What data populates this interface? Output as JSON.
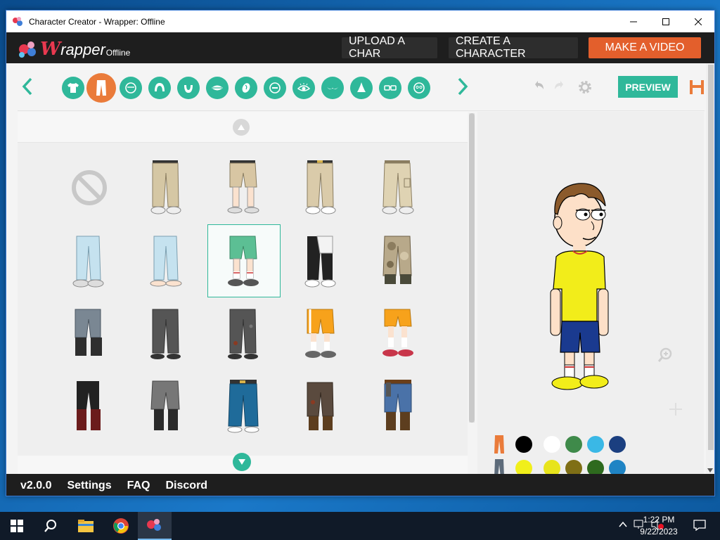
{
  "window": {
    "title": "Character Creator - Wrapper: Offline",
    "controls": [
      "minimize",
      "maximize",
      "close"
    ]
  },
  "header": {
    "logo_w": "W",
    "logo_rest": "rapper",
    "logo_offline": "Offline",
    "upload_label": "UPLOAD A CHAR",
    "create_label": "CREATE A CHARACTER",
    "make_video_label": "MAKE A VIDEO"
  },
  "toolbar": {
    "categories": [
      "shirt",
      "pants",
      "face-shape",
      "hair",
      "beard",
      "mouth",
      "ear",
      "eyebrow",
      "eye",
      "mustache",
      "nose",
      "glasses",
      "glasses-face"
    ],
    "active_category": "pants",
    "preview_label": "PREVIEW"
  },
  "footer": {
    "version": "v2.0.0",
    "settings": "Settings",
    "faq": "FAQ",
    "discord": "Discord"
  },
  "colors": {
    "accent": "#2fb89a",
    "active_tab": "#ea7b3a",
    "make_video": "#e35f2c",
    "top_swatches": [
      "#000000",
      "#ffffff",
      "#3f8a4a",
      "#3ab8e6",
      "#1b3f80"
    ],
    "bottom_swatches": [
      "#f1ef1a",
      "#e8e41c",
      "#7f6f16",
      "#2e6a1e",
      "#1f84c4"
    ]
  },
  "taskbar": {
    "time": "1:22 PM",
    "date": "9/22/2023"
  }
}
